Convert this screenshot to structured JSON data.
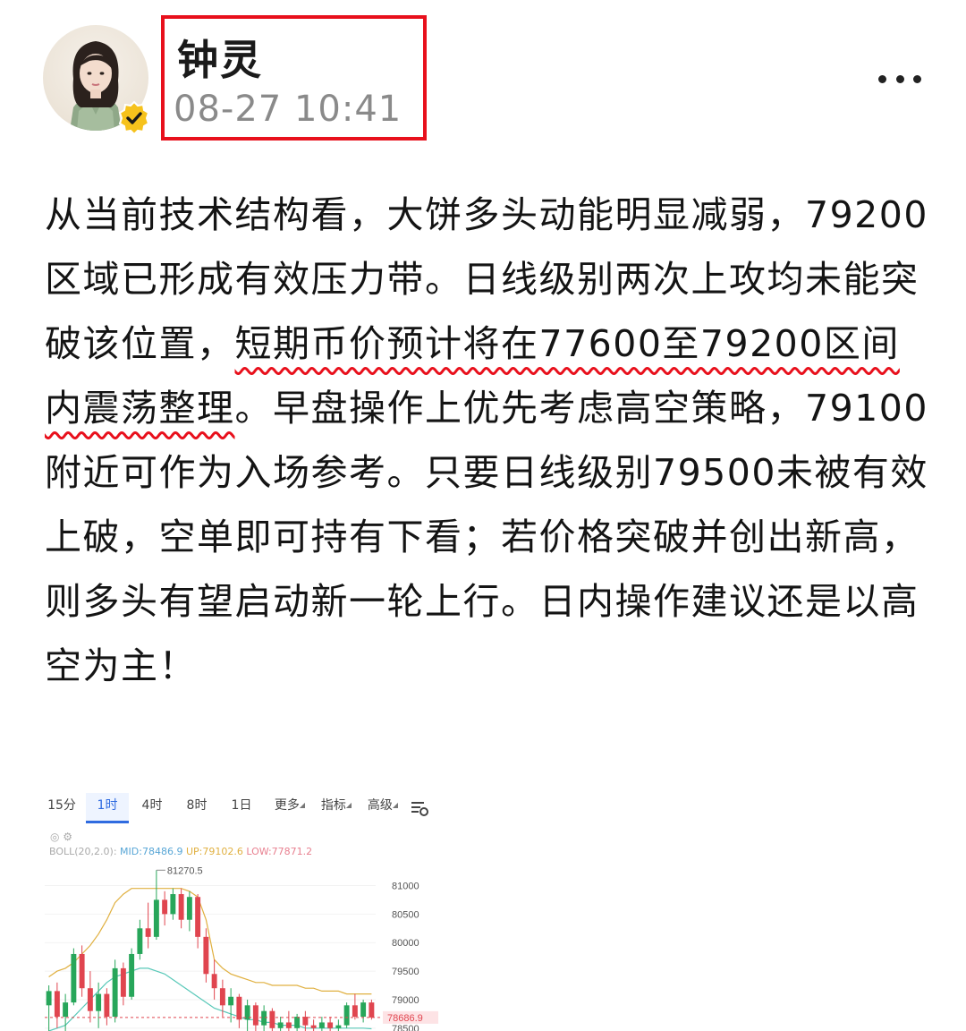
{
  "author": {
    "name": "钟灵",
    "time": "08-27 10:41"
  },
  "post": {
    "text_before": "从当前技术结构看，大饼多头动能明显减弱，79200区域已形成有效压力带。日线级别两次上攻均未能突破该位置，",
    "text_highlight": "短期币价预计将在77600至79200区间内震荡整理",
    "text_after": "。早盘操作上优先考虑高空策略，79100附近可作为入场参考。只要日线级别79500未被有效上破，空单即可持有下看；若价格突破并创出新高，则多头有望启动新一轮上行。日内操作建议还是以高空为主！"
  },
  "chart_tabs": [
    "15分",
    "1时",
    "4时",
    "8时",
    "1日",
    "更多",
    "指标",
    "高级"
  ],
  "chart_active_tab": "1时",
  "boll": {
    "label": "BOLL(20,2.0):",
    "mid": "MID:78486.9",
    "up": "UP:79102.6",
    "low": "LOW:77871.2"
  },
  "colors": {
    "highlight_underline": "#e8101c",
    "name_box_border": "#e8101c",
    "candle_up": "#27a65a",
    "candle_down": "#e0454f",
    "boll_upper": "#e0b040",
    "boll_mid": "#58c8b8",
    "active_tab": "#2f6be0"
  },
  "icons": {
    "verified": "verified-badge-icon",
    "more": "more-dots-icon",
    "chart_settings": "chart-settings-icon"
  },
  "chart_data": {
    "type": "candlestick",
    "high_label": "81270.5",
    "last_price_label": "78686.9",
    "y_ticks": [
      81000,
      80500,
      80000,
      79500,
      79000,
      78500
    ],
    "ylim": [
      78450,
      81400
    ],
    "candles": [
      {
        "o": 78900,
        "h": 79250,
        "l": 78450,
        "c": 79150
      },
      {
        "o": 79150,
        "h": 79300,
        "l": 78500,
        "c": 78700
      },
      {
        "o": 78700,
        "h": 79100,
        "l": 78450,
        "c": 78950
      },
      {
        "o": 78950,
        "h": 79900,
        "l": 78900,
        "c": 79800
      },
      {
        "o": 79800,
        "h": 79950,
        "l": 79050,
        "c": 79200
      },
      {
        "o": 79200,
        "h": 79500,
        "l": 78600,
        "c": 78800
      },
      {
        "o": 78800,
        "h": 79300,
        "l": 78500,
        "c": 79100
      },
      {
        "o": 79100,
        "h": 79200,
        "l": 78550,
        "c": 78700
      },
      {
        "o": 78700,
        "h": 79700,
        "l": 78600,
        "c": 79550
      },
      {
        "o": 79550,
        "h": 79650,
        "l": 78900,
        "c": 79050
      },
      {
        "o": 79050,
        "h": 79900,
        "l": 79000,
        "c": 79800
      },
      {
        "o": 79800,
        "h": 80400,
        "l": 79700,
        "c": 80250
      },
      {
        "o": 80250,
        "h": 80700,
        "l": 79900,
        "c": 80100
      },
      {
        "o": 80100,
        "h": 81270,
        "l": 80050,
        "c": 80750
      },
      {
        "o": 80750,
        "h": 80900,
        "l": 80300,
        "c": 80500
      },
      {
        "o": 80500,
        "h": 80950,
        "l": 80400,
        "c": 80850
      },
      {
        "o": 80850,
        "h": 80950,
        "l": 80250,
        "c": 80400
      },
      {
        "o": 80400,
        "h": 80900,
        "l": 80200,
        "c": 80800
      },
      {
        "o": 80800,
        "h": 80850,
        "l": 79900,
        "c": 80100
      },
      {
        "o": 80100,
        "h": 80250,
        "l": 79300,
        "c": 79450
      },
      {
        "o": 79450,
        "h": 79700,
        "l": 79000,
        "c": 79200
      },
      {
        "o": 79200,
        "h": 79350,
        "l": 78700,
        "c": 78900
      },
      {
        "o": 78900,
        "h": 79200,
        "l": 78600,
        "c": 79050
      },
      {
        "o": 79050,
        "h": 79100,
        "l": 78500,
        "c": 78650
      },
      {
        "o": 78650,
        "h": 79000,
        "l": 78450,
        "c": 78900
      },
      {
        "o": 78900,
        "h": 78950,
        "l": 78450,
        "c": 78550
      },
      {
        "o": 78550,
        "h": 78900,
        "l": 78450,
        "c": 78800
      },
      {
        "o": 78800,
        "h": 78850,
        "l": 78450,
        "c": 78500
      },
      {
        "o": 78500,
        "h": 78700,
        "l": 78450,
        "c": 78600
      },
      {
        "o": 78600,
        "h": 78800,
        "l": 78450,
        "c": 78500
      },
      {
        "o": 78500,
        "h": 78750,
        "l": 78450,
        "c": 78700
      },
      {
        "o": 78700,
        "h": 78800,
        "l": 78450,
        "c": 78550
      },
      {
        "o": 78550,
        "h": 78650,
        "l": 78450,
        "c": 78500
      },
      {
        "o": 78500,
        "h": 78700,
        "l": 78450,
        "c": 78600
      },
      {
        "o": 78600,
        "h": 78700,
        "l": 78450,
        "c": 78500
      },
      {
        "o": 78500,
        "h": 78650,
        "l": 78450,
        "c": 78550
      },
      {
        "o": 78550,
        "h": 78950,
        "l": 78500,
        "c": 78900
      },
      {
        "o": 78900,
        "h": 79100,
        "l": 78650,
        "c": 78700
      },
      {
        "o": 78700,
        "h": 79000,
        "l": 78600,
        "c": 78950
      },
      {
        "o": 78950,
        "h": 79000,
        "l": 78650,
        "c": 78687
      }
    ],
    "boll_upper": [
      79400,
      79500,
      79550,
      79650,
      79800,
      79950,
      80150,
      80400,
      80700,
      80850,
      80950,
      80950,
      80950,
      80950,
      80950,
      80950,
      80950,
      80900,
      80800,
      80400,
      79700,
      79550,
      79450,
      79400,
      79350,
      79300,
      79300,
      79250,
      79250,
      79250,
      79250,
      79200,
      79200,
      79150,
      79150,
      79150,
      79100,
      79100,
      79100,
      79100
    ],
    "boll_mid": [
      78450,
      78500,
      78550,
      78700,
      78850,
      79000,
      79150,
      79300,
      79400,
      79450,
      79500,
      79550,
      79550,
      79500,
      79450,
      79350,
      79250,
      79150,
      79050,
      78950,
      78850,
      78800,
      78750,
      78700,
      78650,
      78650,
      78600,
      78600,
      78550,
      78550,
      78550,
      78500,
      78500,
      78500,
      78500,
      78500,
      78500,
      78500,
      78500,
      78490
    ]
  }
}
